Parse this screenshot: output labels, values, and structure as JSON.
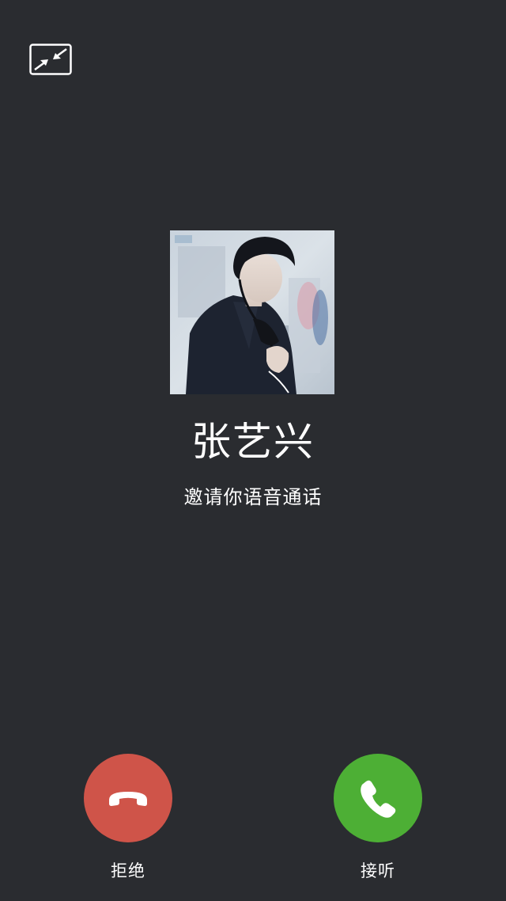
{
  "screen": {
    "background_color": "#2a2c30"
  },
  "toolbar": {
    "minimize_icon": "minimize-window-icon"
  },
  "caller": {
    "name": "张艺兴",
    "subtitle": "邀请你语音通话",
    "avatar_icon": "caller-avatar-photo"
  },
  "actions": {
    "decline": {
      "label": "拒绝",
      "icon": "phone-hangup-icon",
      "color": "#cf5449"
    },
    "accept": {
      "label": "接听",
      "icon": "phone-answer-icon",
      "color": "#4daf35"
    }
  }
}
